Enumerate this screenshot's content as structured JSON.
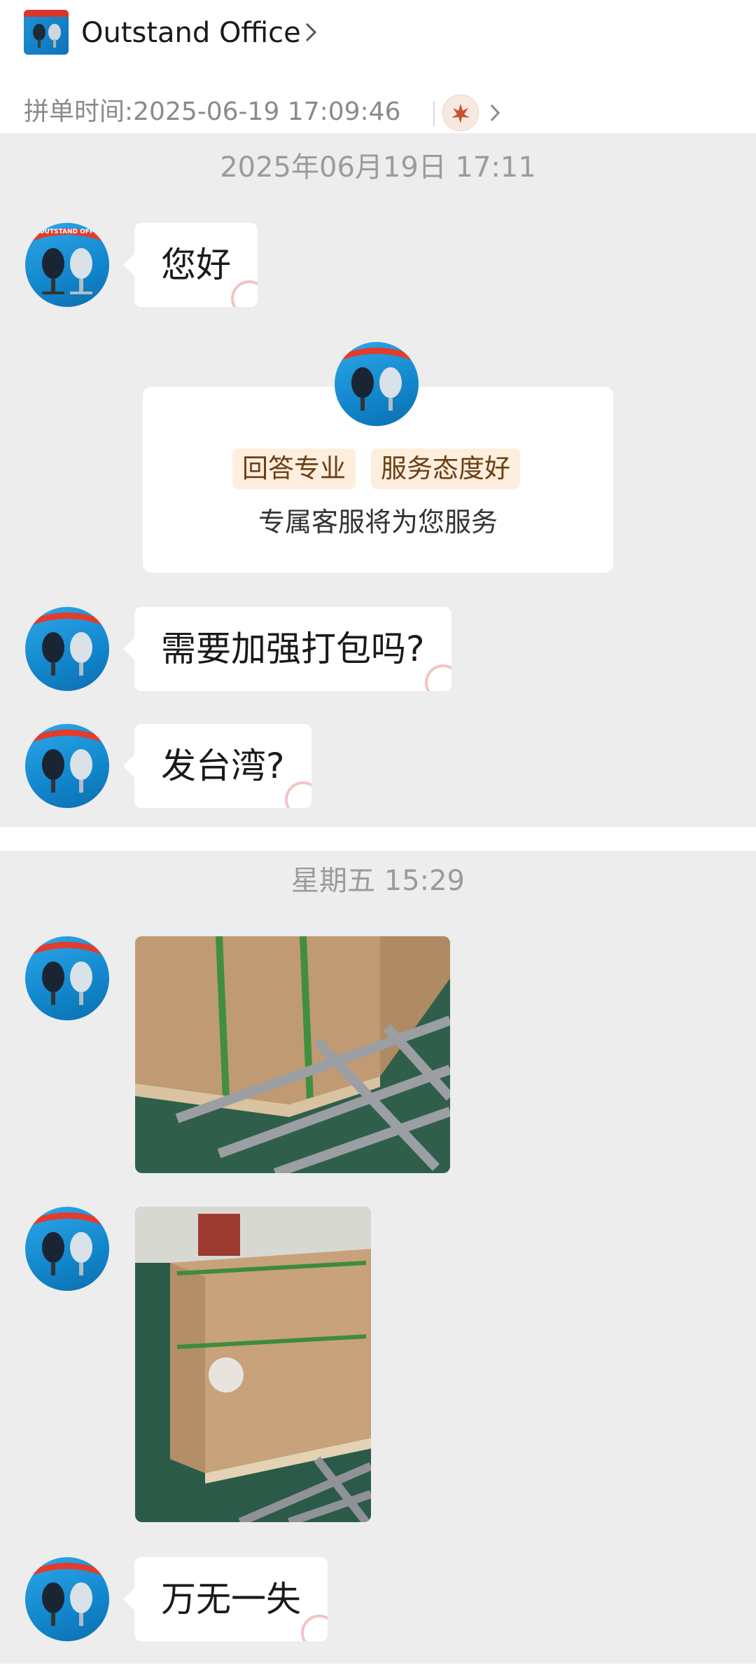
{
  "header": {
    "store_name": "Outstand Office",
    "order_time_label": "拼单时间:",
    "order_time_value": "2025-06-19 17:09:46"
  },
  "avatar_banner_text": "OUTSTAND OFFICE",
  "messages_section1": {
    "timestamp": "2025年06月19日 17:11",
    "greeting": "您好",
    "service_card": {
      "tags": [
        "回答专业",
        "服务态度好"
      ],
      "text": "专属客服将为您服务"
    },
    "message2": "需要加强打包吗?",
    "message3": "发台湾?"
  },
  "messages_section2": {
    "timestamp": "星期五 15:29",
    "message_last": "万无一失"
  },
  "icons": {
    "chevron": "chevron-right-icon",
    "stamp": "pin-stamp-icon"
  }
}
